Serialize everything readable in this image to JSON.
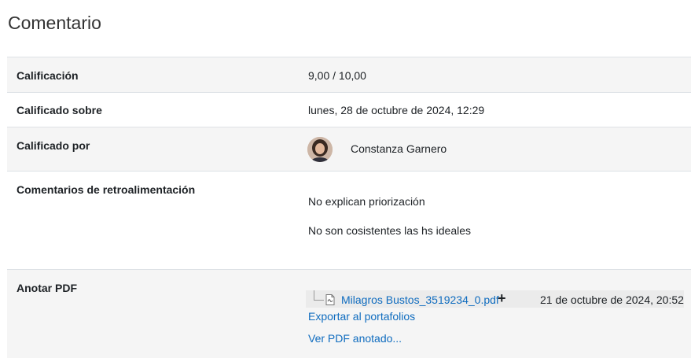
{
  "page": {
    "title": "Comentario"
  },
  "rows": {
    "grade": {
      "label": "Calificación",
      "value": "9,00 / 10,00"
    },
    "graded_on": {
      "label": "Calificado sobre",
      "value": "lunes, 28 de octubre de 2024, 12:29"
    },
    "graded_by": {
      "label": "Calificado por",
      "name": "Constanza Garnero"
    },
    "feedback": {
      "label": "Comentarios de retroalimentación",
      "lines": [
        "No explican priorización",
        "No son cosistentes las hs ideales"
      ]
    },
    "annotate": {
      "label": "Anotar PDF",
      "file_name": "Milagros Bustos_3519234_0.pdf",
      "file_date": "21 de octubre de 2024, 20:52",
      "export_link": "Exportar al portafolios",
      "view_link": "Ver PDF anotado..."
    }
  },
  "icons": {
    "file": "pdf-file-icon",
    "add": "plus-icon",
    "tree": "tree-branch-icon"
  },
  "colors": {
    "link": "#0f6cbf",
    "row_shade": "#f5f5f5",
    "border": "#dee2e6"
  }
}
